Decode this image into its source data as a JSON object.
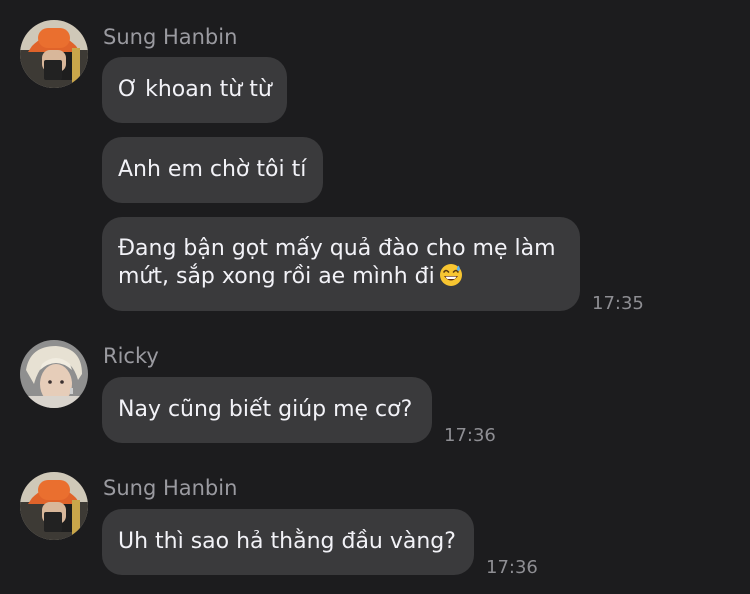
{
  "messages": [
    {
      "sender": "Sung Hanbin",
      "avatar_icon": "avatar-sung-hanbin-orange-bucket-hat",
      "bubbles": [
        {
          "text": "Ơ khoan từ từ",
          "time": ""
        },
        {
          "text": "Anh em chờ tôi tí",
          "time": ""
        },
        {
          "lines": [
            "Đang bận gọt mấy quả đào cho mẹ làm",
            "mứt, sắp xong rồi ae mình đi"
          ],
          "emoji": "grinning-sweat-emoji",
          "time": "17:35"
        }
      ]
    },
    {
      "sender": "Ricky",
      "avatar_icon": "avatar-ricky-blonde-hair",
      "bubbles": [
        {
          "text": "Nay cũng biết giúp mẹ cơ?",
          "time": "17:36"
        }
      ]
    },
    {
      "sender": "Sung Hanbin",
      "avatar_icon": "avatar-sung-hanbin-orange-bucket-hat",
      "bubbles": [
        {
          "text": "Uh thì sao hả thằng đầu vàng?",
          "time": "17:36"
        }
      ]
    }
  ],
  "colors": {
    "background": "#1c1c1e",
    "bubble": "#3a3a3c",
    "sender_name": "#9a9aa0",
    "timestamp": "#8e8e93",
    "message_text": "#f2f2f7"
  }
}
